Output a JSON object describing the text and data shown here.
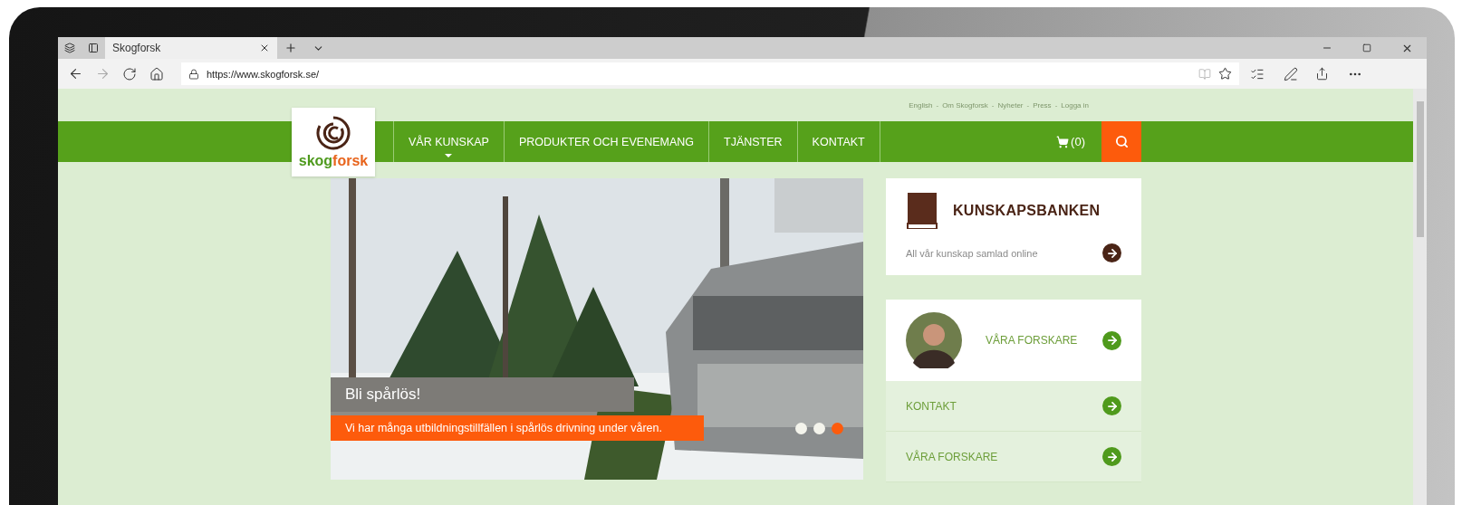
{
  "browser": {
    "tabs": [
      {
        "title": "Skogforsk",
        "selected": true
      }
    ],
    "address": "https://www.skogforsk.se/"
  },
  "top_links": {
    "separator": "-",
    "items": [
      "English",
      "Om Skogforsk",
      "Nyheter",
      "Press",
      "Logga in"
    ]
  },
  "logo": {
    "part_1": "skog",
    "part_2": "forsk"
  },
  "nav": {
    "items": [
      {
        "label": "VÅR KUNSKAP",
        "selected": true
      },
      {
        "label": "PRODUKTER OCH EVENEMANG",
        "selected": false
      },
      {
        "label": "TJÄNSTER",
        "selected": false
      },
      {
        "label": "KONTAKT",
        "selected": false
      }
    ],
    "cart": "(0)"
  },
  "hero": {
    "title": "Bli spårlös!",
    "caption": "Vi har många utbildningstillfällen i spårlös drivning under våren.",
    "dots": [
      {
        "selected": false
      },
      {
        "selected": false
      },
      {
        "selected": true
      }
    ]
  },
  "sidebar": {
    "knowledge_bank": {
      "title": "KUNSKAPSBANKEN",
      "subtitle": "All vår kunskap samlad online"
    },
    "researchers": {
      "label": "VÅRA FORSKARE"
    },
    "links": [
      {
        "label": "KONTAKT"
      },
      {
        "label": "VÅRA FORSKARE"
      }
    ]
  }
}
